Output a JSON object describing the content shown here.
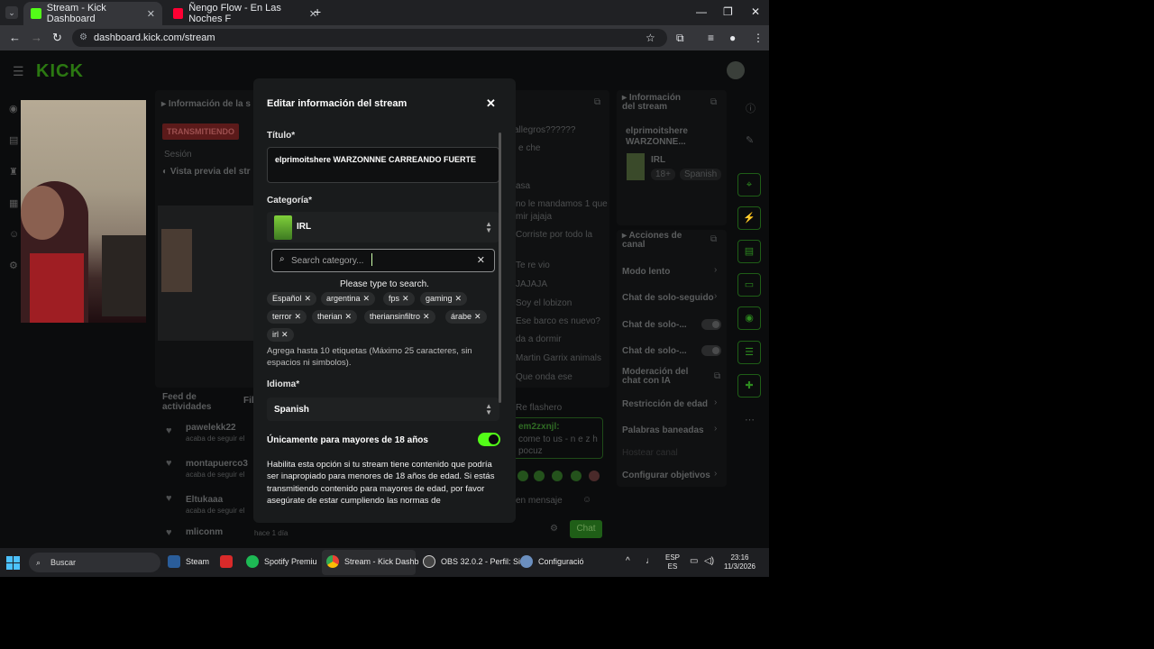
{
  "browser": {
    "tabs": [
      {
        "title": "Stream - Kick Dashboard",
        "active": true
      },
      {
        "title": "Ñengo Flow - En Las Noches F",
        "active": false
      }
    ],
    "url": "dashboard.kick.com/stream"
  },
  "dashboard": {
    "logo": "KICK",
    "panel_info_title": "Información de la s",
    "live_badge": "TRANSMITIENDO",
    "session_label": "Sesión",
    "preview_label": "Vista previa del str",
    "activity_title": "Feed de actividades",
    "filter_label": "Fil",
    "activity_items": [
      {
        "user": "pawelekk22",
        "sub": "acaba de seguir el"
      },
      {
        "user": "montapuerco3",
        "sub": "acaba de seguir el"
      },
      {
        "user": "Eltukaaa",
        "sub": "acaba de seguir el"
      },
      {
        "user": "mliconm",
        "sub": "hace 1 día"
      }
    ],
    "chat_lines": [
      "allegros??????",
      "e che",
      "asa",
      "no le mandamos 1 que",
      "mir jajaja",
      "Corriste por todo la",
      "Te re vio",
      "JAJAJA",
      "Soy el lobizon",
      "Ese barco es nuevo?",
      "da a dormir",
      "Martin Garrix animals",
      "Que onda ese",
      "Re flashero",
      "em2zxnjl:",
      "come to us - n e z h",
      "pocuz",
      "en mensaje"
    ],
    "chat_button": "Chat",
    "stream_info": {
      "title": "Información del stream",
      "stream_title": "elprimoitshere WARZONNE...",
      "category": "IRL",
      "tags": [
        "18+",
        "Spanish"
      ]
    },
    "channel_actions": {
      "title": "Acciones de canal",
      "items": [
        "Modo lento",
        "Chat de solo-seguido",
        "Chat de solo-...",
        "Chat de solo-...",
        "Moderación del chat con IA",
        "Restricción de edad",
        "Palabras baneadas",
        "Hostear canal",
        "Configurar objetivos"
      ]
    }
  },
  "modal": {
    "title": "Editar información del stream",
    "title_label": "Título*",
    "title_value": "elprimoitshere WARZONNNE CARREANDO FUERTE",
    "category_label": "Categoría*",
    "category_value": "IRL",
    "search_placeholder": "Search category...",
    "search_hint": "Please type to search.",
    "tags": [
      "Español",
      "argentina",
      "fps",
      "gaming",
      "terror",
      "therian",
      "theriansinfiltro",
      "árabe",
      "irl"
    ],
    "tags_hint": "Agrega hasta 10 etiquetas (Máximo 25 caracteres, sin espacios ni simbolos).",
    "language_label": "Idioma*",
    "language_value": "Spanish",
    "adult_label": "Únicamente para mayores de 18 años",
    "adult_enabled": true,
    "adult_desc": "Habilita esta opción si tu stream tiene contenido que podría ser inapropiado para menores de 18 años de edad. Si estás transmitiendo contenido para mayores de edad, por favor asegúrate de estar cumpliendo las normas de"
  },
  "taskbar": {
    "search": "Buscar",
    "apps": [
      "Steam",
      "Spotify Premiu",
      "Stream - Kick Dashb",
      "OBS 32.0.2 - Perfil: Si",
      "Configuració"
    ],
    "lang": [
      "ESP",
      "ES"
    ],
    "time": "23:16",
    "date": "11/3/2026"
  },
  "colors": {
    "accent": "#53fc18",
    "modal_bg": "#191b1c"
  }
}
